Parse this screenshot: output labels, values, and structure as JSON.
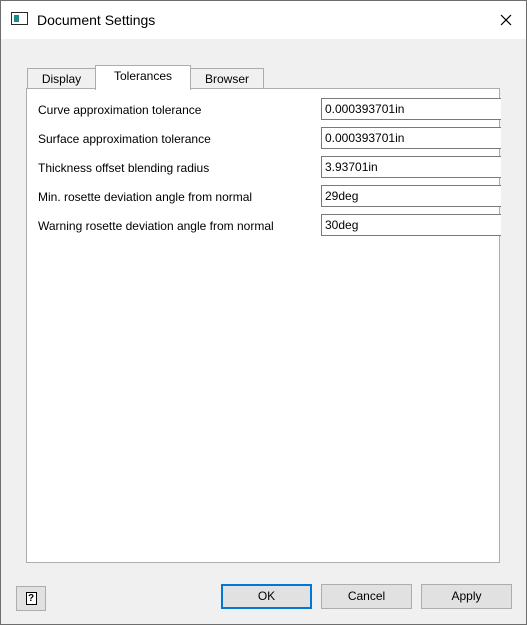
{
  "window": {
    "title": "Document Settings",
    "close_icon": "close-icon",
    "app_icon": "window-icon"
  },
  "tabs": [
    {
      "label": "Display",
      "active": false
    },
    {
      "label": "Tolerances",
      "active": true
    },
    {
      "label": "Browser",
      "active": false
    }
  ],
  "settings": [
    {
      "label": "Curve approximation tolerance",
      "value": "0.000393701in"
    },
    {
      "label": "Surface approximation tolerance",
      "value": "0.000393701in"
    },
    {
      "label": "Thickness offset blending radius",
      "value": "3.93701in"
    },
    {
      "label": "Min. rosette deviation angle from normal",
      "value": "29deg"
    },
    {
      "label": "Warning rosette deviation angle from normal",
      "value": "30deg"
    }
  ],
  "buttons": {
    "help_glyph": "?",
    "ok": "OK",
    "cancel": "Cancel",
    "apply": "Apply"
  }
}
